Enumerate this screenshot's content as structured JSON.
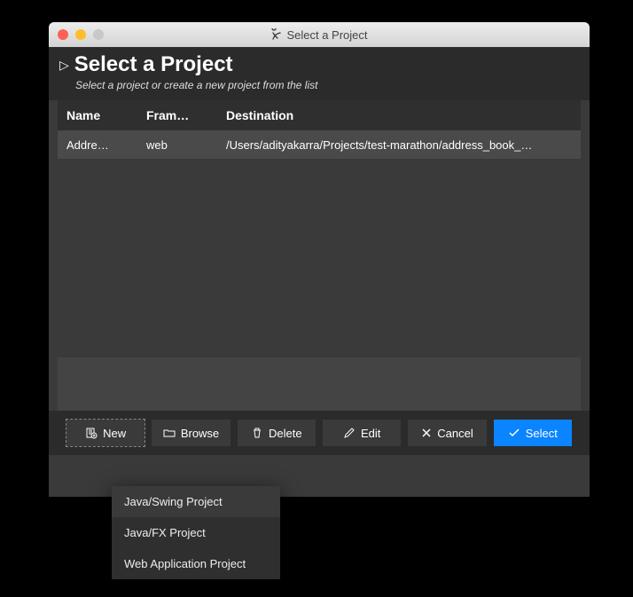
{
  "titlebar": {
    "title": "Select a Project"
  },
  "header": {
    "title": "Select a Project",
    "subtitle": "Select a project or create a new project from the list"
  },
  "columns": {
    "name": "Name",
    "framework": "Fram…",
    "destination": "Destination"
  },
  "rows": [
    {
      "name": "Addre…",
      "framework": "web",
      "destination": "/Users/adityakarra/Projects/test-marathon/address_book_…"
    }
  ],
  "buttons": {
    "new": "New",
    "browse": "Browse",
    "delete": "Delete",
    "edit": "Edit",
    "cancel": "Cancel",
    "select": "Select"
  },
  "menu": {
    "item1": "Java/Swing Project",
    "item2": "Java/FX Project",
    "item3": "Web Application Project"
  }
}
